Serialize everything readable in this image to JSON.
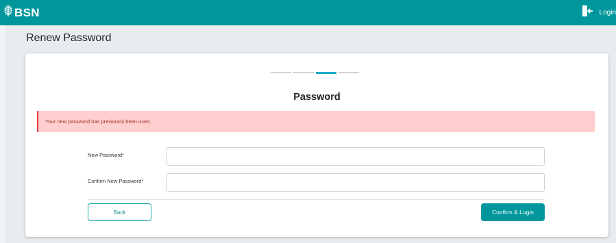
{
  "header": {
    "logo_text": "BSN",
    "login_label": "Login",
    "brand_color": "#00979c"
  },
  "page": {
    "title": "Renew Password"
  },
  "steps": {
    "count": 4,
    "active_index": 2
  },
  "card": {
    "title": "Password"
  },
  "alert": {
    "message": "Your new password has previously been used."
  },
  "form": {
    "new_password_label": "New Password*",
    "new_password_value": "",
    "confirm_password_label": "Confirm New Password*",
    "confirm_password_value": ""
  },
  "actions": {
    "back_label": "Back",
    "confirm_label": "Confirm & Login"
  }
}
